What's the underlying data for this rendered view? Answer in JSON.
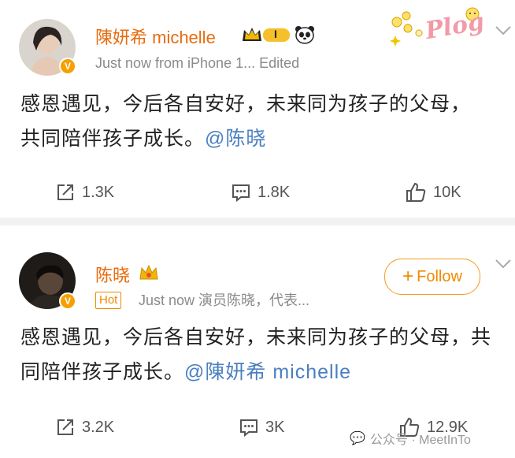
{
  "post1": {
    "author": "陳妍希 michelle",
    "level_badge": "I",
    "meta": "Just now  from iPhone 1...  Edited",
    "text": "感恩遇见，今后各自安好，未来同为孩子的父母，  共同陪伴孩子成长。",
    "mention": "@陈晓",
    "actions": {
      "share": "1.3K",
      "comment": "1.8K",
      "like": "10K"
    },
    "sticker_text": "Plog"
  },
  "post2": {
    "author": "陈晓",
    "hot_label": "Hot",
    "meta": "Just now  演员陈晓，代表...",
    "follow_label": "Follow",
    "text": "感恩遇见，今后各自安好，未来同为孩子的父母，共同陪伴孩子成长。",
    "mention": "@陳妍希 michelle",
    "actions": {
      "share": "3.2K",
      "comment": "3K",
      "like": "12.9K"
    }
  },
  "watermark": "公众号 · MeetInTo",
  "colors": {
    "name": "#e86b0c",
    "accent": "#f08a00",
    "mention": "#4a7fc0",
    "divider": "#f2f2f2"
  }
}
